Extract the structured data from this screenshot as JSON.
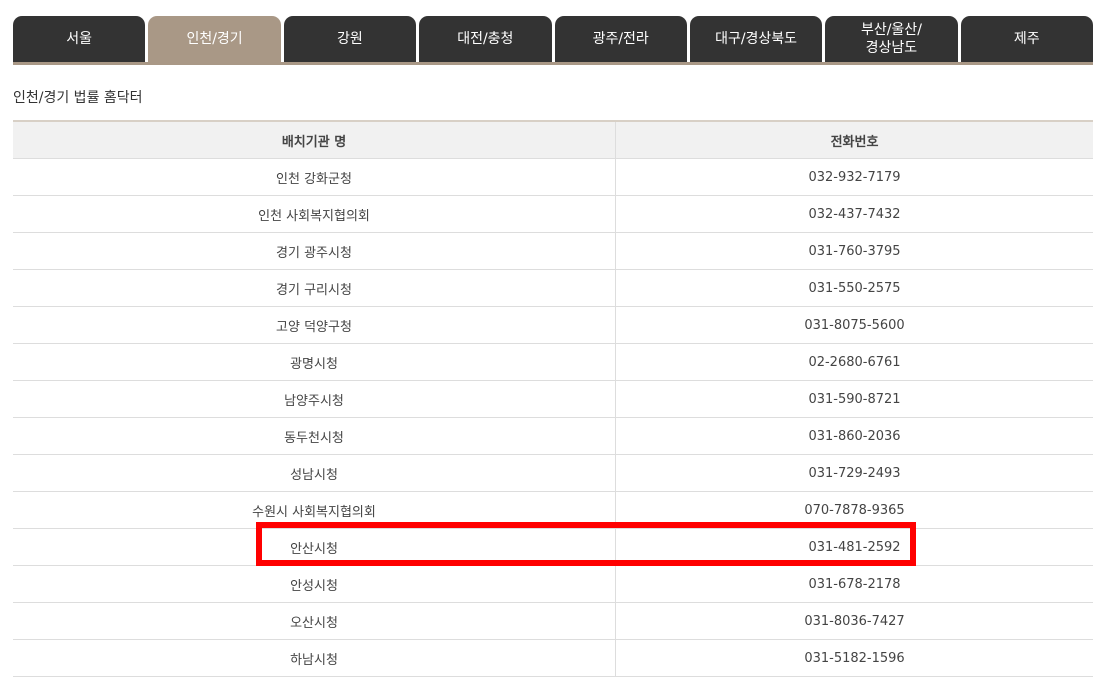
{
  "tabs": [
    "서울",
    "인천/경기",
    "강원",
    "대전/충청",
    "광주/전라",
    "대구/경상북도",
    "부산/울산/\n경상남도",
    "제주"
  ],
  "active_tab": "인천/경기",
  "section_title": "인천/경기 법률 홈닥터",
  "table": {
    "headers": [
      "배치기관 명",
      "전화번호"
    ],
    "rows": [
      {
        "name": "인천 강화군청",
        "phone": "032-932-7179"
      },
      {
        "name": "인천 사회복지협의회",
        "phone": "032-437-7432"
      },
      {
        "name": "경기 광주시청",
        "phone": "031-760-3795"
      },
      {
        "name": "경기 구리시청",
        "phone": "031-550-2575"
      },
      {
        "name": "고양 덕양구청",
        "phone": "031-8075-5600"
      },
      {
        "name": "광명시청",
        "phone": "02-2680-6761"
      },
      {
        "name": "남양주시청",
        "phone": "031-590-8721"
      },
      {
        "name": "동두천시청",
        "phone": "031-860-2036"
      },
      {
        "name": "성남시청",
        "phone": "031-729-2493"
      },
      {
        "name": "수원시 사회복지협의회",
        "phone": "070-7878-9365"
      },
      {
        "name": "안산시청",
        "phone": "031-481-2592"
      },
      {
        "name": "안성시청",
        "phone": "031-678-2178"
      },
      {
        "name": "오산시청",
        "phone": "031-8036-7427"
      },
      {
        "name": "하남시청",
        "phone": "031-5182-1596"
      }
    ]
  },
  "highlighted_row": "안산시청",
  "colors": {
    "tab_bg": "#333333",
    "tab_active_bg": "#a99886",
    "highlight_border": "#ff0000"
  }
}
